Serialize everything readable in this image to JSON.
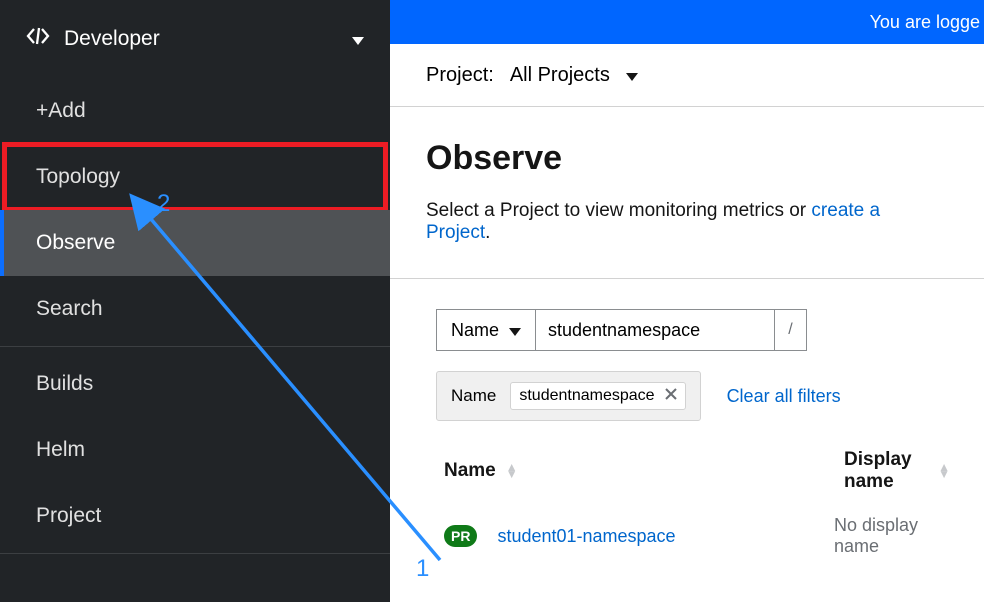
{
  "perspective": {
    "label": "Developer"
  },
  "sidebar": {
    "add": "+Add",
    "topology": "Topology",
    "observe": "Observe",
    "search": "Search",
    "builds": "Builds",
    "helm": "Helm",
    "project": "Project"
  },
  "banner": {
    "text": "You are logge"
  },
  "projectbar": {
    "label": "Project:",
    "value": "All Projects"
  },
  "page": {
    "title": "Observe",
    "hint_pre": "Select a Project to view monitoring metrics or ",
    "hint_link": "create a Project",
    "hint_post": "."
  },
  "filter": {
    "type_label": "Name",
    "input_value": "studentnamespace",
    "slash": "/"
  },
  "chips": {
    "group_label": "Name",
    "chip_value": "studentnamespace",
    "clear": "Clear all filters"
  },
  "table": {
    "col_name": "Name",
    "col_display": "Display name",
    "rows": [
      {
        "badge": "PR",
        "name": "student01-namespace",
        "display": "No display name"
      }
    ]
  },
  "annot": {
    "one": "1",
    "two": "2"
  }
}
